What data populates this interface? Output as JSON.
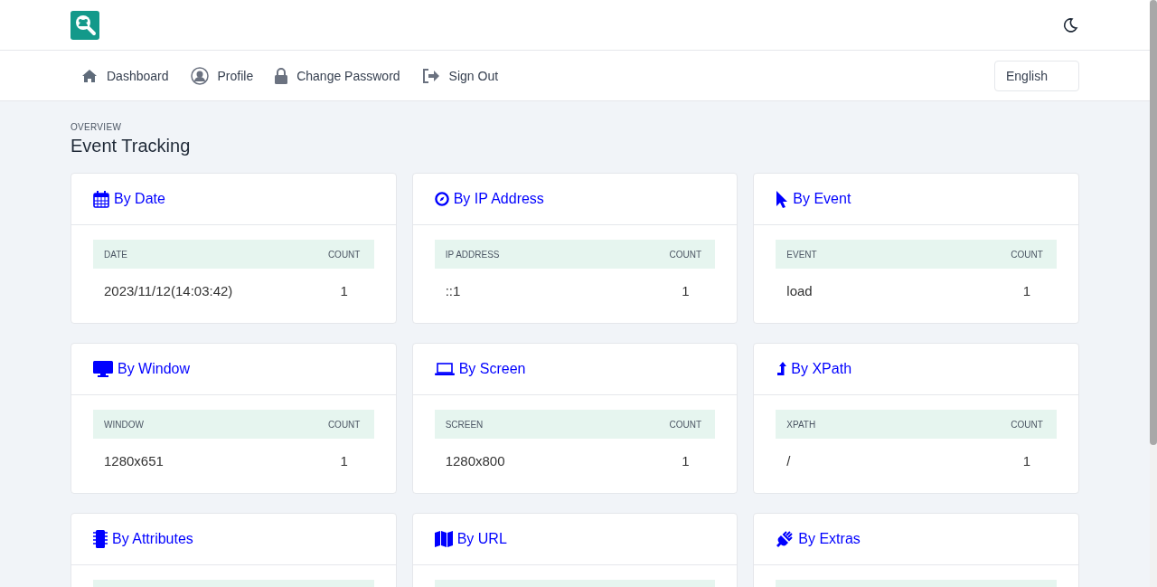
{
  "nav": [
    {
      "label": "Dashboard"
    },
    {
      "label": "Profile"
    },
    {
      "label": "Change Password"
    },
    {
      "label": "Sign Out"
    }
  ],
  "language": {
    "value": "English"
  },
  "page": {
    "eyebrow": "OVERVIEW",
    "title": "Event Tracking"
  },
  "cards": [
    {
      "title": "By Date",
      "columns": [
        "DATE",
        "COUNT"
      ],
      "rows": [
        [
          "2023/11/12(14:03:42)",
          "1"
        ]
      ]
    },
    {
      "title": "By IP Address",
      "columns": [
        "IP ADDRESS",
        "COUNT"
      ],
      "rows": [
        [
          "::1",
          "1"
        ]
      ]
    },
    {
      "title": "By Event",
      "columns": [
        "EVENT",
        "COUNT"
      ],
      "rows": [
        [
          "load",
          "1"
        ]
      ]
    },
    {
      "title": "By Window",
      "columns": [
        "WINDOW",
        "COUNT"
      ],
      "rows": [
        [
          "1280x651",
          "1"
        ]
      ]
    },
    {
      "title": "By Screen",
      "columns": [
        "SCREEN",
        "COUNT"
      ],
      "rows": [
        [
          "1280x800",
          "1"
        ]
      ]
    },
    {
      "title": "By XPath",
      "columns": [
        "XPATH",
        "COUNT"
      ],
      "rows": [
        [
          "/",
          "1"
        ]
      ]
    },
    {
      "title": "By Attributes"
    },
    {
      "title": "By URL"
    },
    {
      "title": "By Extras"
    }
  ]
}
